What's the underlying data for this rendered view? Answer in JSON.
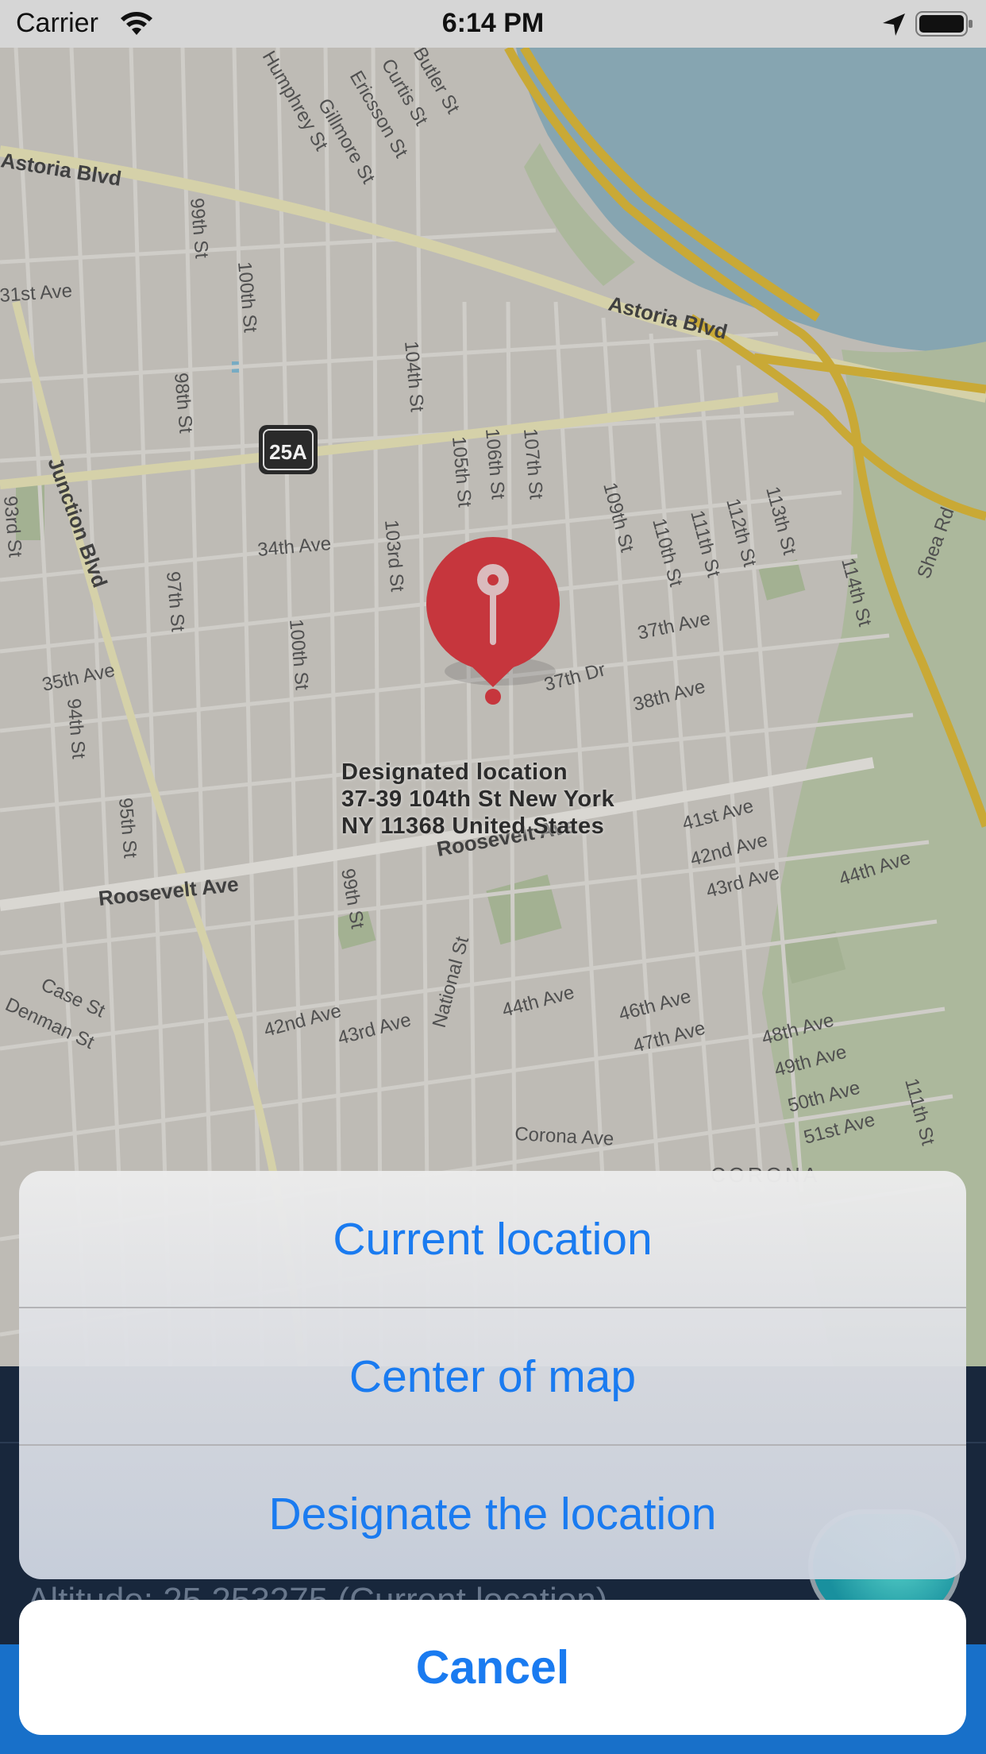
{
  "status_bar": {
    "carrier": "Carrier",
    "time": "6:14 PM",
    "icons": [
      "wifi-icon",
      "location-arrow-icon",
      "battery-icon"
    ]
  },
  "map": {
    "pin": {
      "title": "Designated location",
      "address_line1": "37-39 104th St New York",
      "address_line2": "NY 11368 United States",
      "color": "#d33a41"
    },
    "route_shield": "25A",
    "streets": {
      "s1": "Astoria Blvd",
      "s2": "Astoria Blvd",
      "s3": "31st Ave",
      "s4": "99th St",
      "s5": "100th St",
      "s6": "104th St",
      "s7": "98th St",
      "s8": "Junction Blvd",
      "s9": "105th St",
      "s10": "106th St",
      "s11": "107th St",
      "s12": "34th Ave",
      "s13": "103rd St",
      "s14": "109th St",
      "s15": "110th St",
      "s16": "111th St",
      "s17": "112th St",
      "s18": "113th St",
      "s19": "114th St",
      "s20": "Shea Rd",
      "s21": "93rd St",
      "s22": "97th St",
      "s23": "100th St",
      "s24": "37th Ave",
      "s25": "37th Dr",
      "s26": "38th Ave",
      "s27": "35th Ave",
      "s28": "94th St",
      "s29": "95th St",
      "s30": "Roosevelt Ave",
      "s31": "Roosevelt Ave",
      "s32": "41st Ave",
      "s33": "42nd Ave",
      "s34": "43rd Ave",
      "s35": "44th Ave",
      "s36": "99th St",
      "s37": "National St",
      "s38": "Case St",
      "s39": "Denman St",
      "s40": "42nd Ave",
      "s41": "43rd Ave",
      "s42": "44th Ave",
      "s43": "46th Ave",
      "s44": "47th Ave",
      "s45": "48th Ave",
      "s46": "49th Ave",
      "s47": "50th Ave",
      "s48": "51st Ave",
      "s49": "111th St",
      "s50": "Corona Ave",
      "s51": "CORONA",
      "s52": "Humphrey St",
      "s53": "Gillmore St",
      "s54": "Ericsson St",
      "s55": "Curtis St",
      "s56": "Butler St"
    }
  },
  "background_panel": {
    "altitude_text": "Altitude: 25.253275 (Current location)"
  },
  "action_sheet": {
    "actions": [
      {
        "label": "Current location"
      },
      {
        "label": "Center of map"
      },
      {
        "label": "Designate the location"
      }
    ],
    "cancel_label": "Cancel",
    "accent_color": "#1a7bf0"
  }
}
